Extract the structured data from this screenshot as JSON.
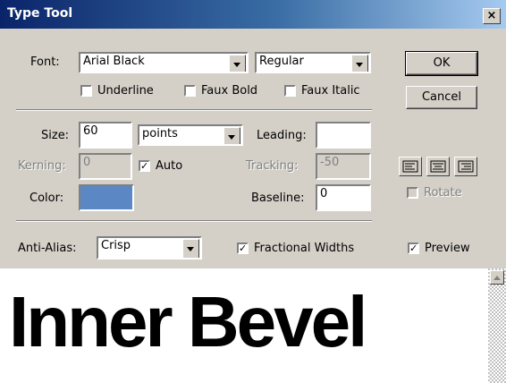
{
  "window": {
    "title": "Type Tool",
    "close_label": "×"
  },
  "font": {
    "label": "Font:",
    "family": "Arial Black",
    "style": "Regular",
    "underline": {
      "label": "Underline",
      "checked": false
    },
    "faux_bold": {
      "label": "Faux Bold",
      "checked": false
    },
    "faux_italic": {
      "label": "Faux Italic",
      "checked": false
    }
  },
  "buttons": {
    "ok": "OK",
    "cancel": "Cancel"
  },
  "size": {
    "label": "Size:",
    "value": "60",
    "unit": "points"
  },
  "leading": {
    "label": "Leading:",
    "value": ""
  },
  "kerning": {
    "label": "Kerning:",
    "value": "0",
    "auto_label": "Auto",
    "auto_checked": true
  },
  "tracking": {
    "label": "Tracking:",
    "value": "-50"
  },
  "color": {
    "label": "Color:",
    "swatch": "#5b87c5"
  },
  "baseline": {
    "label": "Baseline:",
    "value": "0"
  },
  "alignment": {
    "options": [
      "align-left",
      "align-center",
      "align-right"
    ]
  },
  "rotate": {
    "label": "Rotate",
    "checked": false
  },
  "anti_alias": {
    "label": "Anti-Alias:",
    "value": "Crisp"
  },
  "fractional_widths": {
    "label": "Fractional Widths",
    "checked": true
  },
  "preview": {
    "label": "Preview",
    "checked": true,
    "text": "Inner Bevel"
  }
}
